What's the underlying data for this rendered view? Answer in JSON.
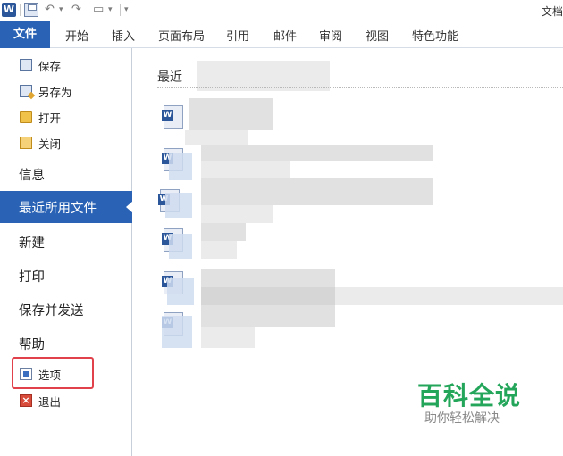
{
  "window": {
    "title_fragment": "文档"
  },
  "qat": {
    "app_logo": "W",
    "glyphs": [
      "↶",
      "▾",
      "↷",
      "▭",
      "▾"
    ]
  },
  "ribbon": {
    "file_tab": "文件",
    "tabs": [
      "开始",
      "插入",
      "页面布局",
      "引用",
      "邮件",
      "审阅",
      "视图",
      "特色功能"
    ]
  },
  "backstage": {
    "commands_top": [
      {
        "label": "保存",
        "icon": "save-icon"
      },
      {
        "label": "另存为",
        "icon": "save-as-icon"
      },
      {
        "label": "打开",
        "icon": "open-folder-icon"
      },
      {
        "label": "关闭",
        "icon": "close-folder-icon"
      }
    ],
    "items": [
      "信息",
      "最近所用文件",
      "新建",
      "打印",
      "保存并发送",
      "帮助"
    ],
    "selected": "最近所用文件",
    "commands_bottom": [
      {
        "label": "选项",
        "icon": "options-icon"
      },
      {
        "label": "退出",
        "icon": "exit-icon"
      }
    ]
  },
  "recent": {
    "section_title": "最近"
  },
  "watermark": {
    "title": "百科全说",
    "subtitle": "助你轻松解决"
  },
  "colors": {
    "accent": "#2a63b5",
    "highlight_border": "#e0414b",
    "watermark_green": "#23a55a"
  }
}
